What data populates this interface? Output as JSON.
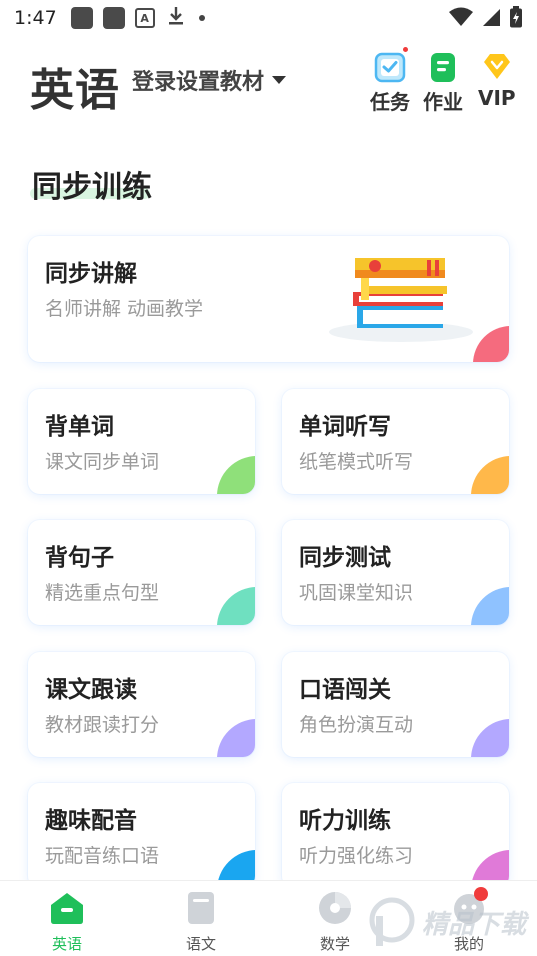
{
  "status_bar": {
    "time": "1:47",
    "icons": [
      "notification-square-icon",
      "notification-square-icon",
      "a-icon",
      "download-icon",
      "dot-icon",
      "wifi-icon",
      "signal-icon",
      "battery-icon"
    ],
    "a_label": "A"
  },
  "header": {
    "subject": "英语",
    "textbook_selector": "登录设置教材",
    "buttons": {
      "task": "任务",
      "homework": "作业",
      "vip": "VIP"
    }
  },
  "section": {
    "title": "同步训练"
  },
  "cards": [
    {
      "title": "同步讲解",
      "subtitle": "名师讲解 动画教学",
      "accent": "#f56b7e"
    },
    {
      "title": "背单词",
      "subtitle": "课文同步单词",
      "accent": "#8fe07a"
    },
    {
      "title": "单词听写",
      "subtitle": "纸笔模式听写",
      "accent": "#ffb84a"
    },
    {
      "title": "背句子",
      "subtitle": "精选重点句型",
      "accent": "#6fe0c0"
    },
    {
      "title": "同步测试",
      "subtitle": "巩固课堂知识",
      "accent": "#8fc2ff"
    },
    {
      "title": "课文跟读",
      "subtitle": "教材跟读打分",
      "accent": "#b3a8ff"
    },
    {
      "title": "口语闯关",
      "subtitle": "角色扮演互动",
      "accent": "#b3a8ff"
    },
    {
      "title": "趣味配音",
      "subtitle": "玩配音练口语",
      "accent": "#1aa6f0"
    },
    {
      "title": "听力训练",
      "subtitle": "听力强化练习",
      "accent": "#e07ad8"
    }
  ],
  "bottom_nav": [
    {
      "label": "英语",
      "active": true
    },
    {
      "label": "语文",
      "active": false
    },
    {
      "label": "数学",
      "active": false
    },
    {
      "label": "我的",
      "active": false
    }
  ],
  "watermark": {
    "text": "精品下载"
  },
  "colors": {
    "brand_green": "#1fbf5a",
    "badge_red": "#f03c3c",
    "vip_yellow": "#ffc61a",
    "task_blue": "#4db7f2"
  }
}
